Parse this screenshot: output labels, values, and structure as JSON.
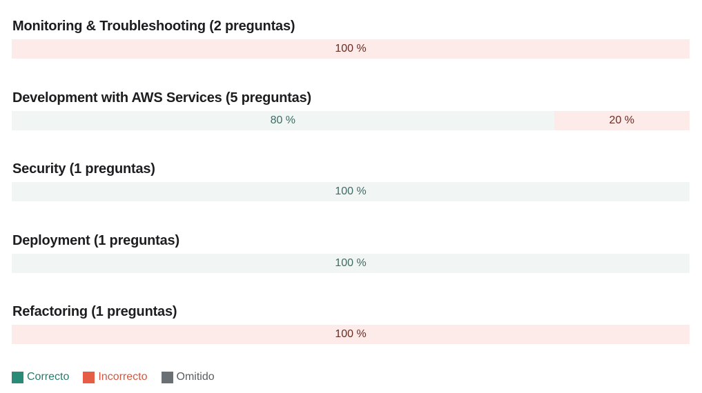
{
  "sections": [
    {
      "title": "Monitoring & Troubleshooting (2 preguntas)",
      "segments": [
        {
          "kind": "incorrect",
          "percent": 100,
          "label": "100 %"
        }
      ]
    },
    {
      "title": "Development with AWS Services (5 preguntas)",
      "segments": [
        {
          "kind": "correct",
          "percent": 80,
          "label": "80 %"
        },
        {
          "kind": "incorrect",
          "percent": 20,
          "label": "20 %"
        }
      ]
    },
    {
      "title": "Security (1 preguntas)",
      "segments": [
        {
          "kind": "correct",
          "percent": 100,
          "label": "100 %"
        }
      ]
    },
    {
      "title": "Deployment (1 preguntas)",
      "segments": [
        {
          "kind": "correct",
          "percent": 100,
          "label": "100 %"
        }
      ]
    },
    {
      "title": "Refactoring (1 preguntas)",
      "segments": [
        {
          "kind": "incorrect",
          "percent": 100,
          "label": "100 %"
        }
      ]
    }
  ],
  "legend": [
    {
      "label": "Correcto",
      "color": "#2a8a78",
      "text_color": "#2a7a6b"
    },
    {
      "label": "Incorrecto",
      "color": "#e55d45",
      "text_color": "#d4563f"
    },
    {
      "label": "Omitido",
      "color": "#6a6f73",
      "text_color": "#5a5e61"
    }
  ]
}
